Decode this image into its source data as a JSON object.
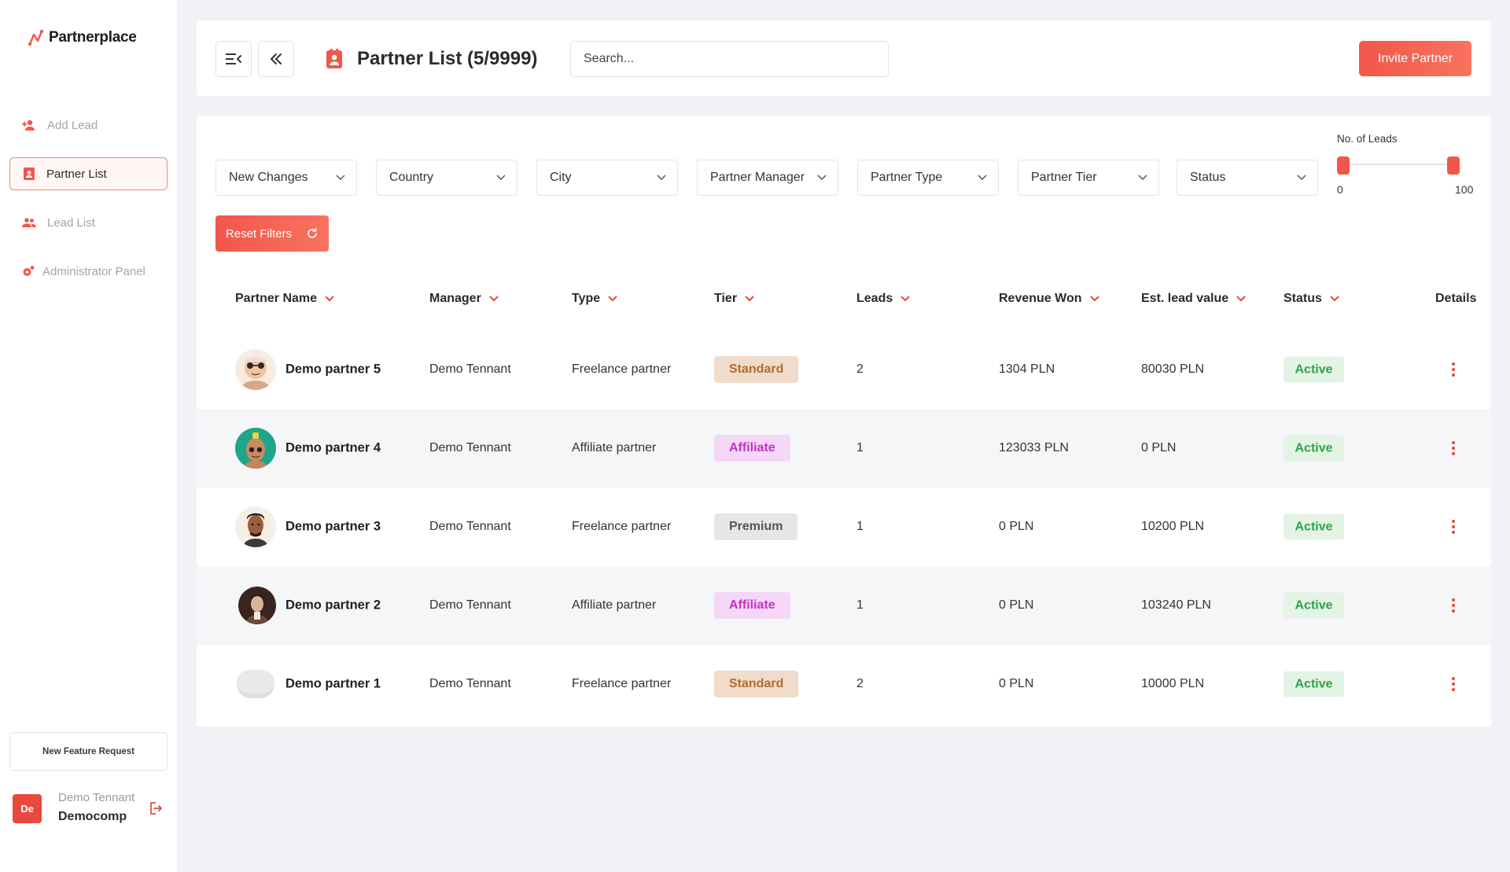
{
  "brand": {
    "name": "Partnerplace"
  },
  "sidebar": {
    "items": [
      {
        "label": "Add Lead",
        "icon": "user-plus-icon"
      },
      {
        "label": "Partner List",
        "icon": "contact-book-icon",
        "active": true
      },
      {
        "label": "Lead List",
        "icon": "users-icon"
      },
      {
        "label": "Administrator Panel",
        "icon": "gear-user-icon"
      }
    ],
    "feature_request": "New Feature Request",
    "user": {
      "initials": "De",
      "name": "Demo Tennant",
      "company": "Democomp"
    }
  },
  "header": {
    "title": "Partner List (5/9999)",
    "search_placeholder": "Search...",
    "invite_label": "Invite Partner"
  },
  "filters": {
    "items": [
      "New Changes",
      "Country",
      "City",
      "Partner Manager",
      "Partner Type",
      "Partner Tier",
      "Status"
    ],
    "leads_range": {
      "label": "No. of Leads",
      "min": "0",
      "max": "100",
      "value_low": 0,
      "value_high": 100
    },
    "reset_label": "Reset Filters"
  },
  "table": {
    "columns": [
      "Partner Name",
      "Manager",
      "Type",
      "Tier",
      "Leads",
      "Revenue Won",
      "Est. lead value",
      "Status",
      "Details"
    ],
    "rows": [
      {
        "name": "Demo partner 5",
        "manager": "Demo Tennant",
        "type": "Freelance partner",
        "tier": "Standard",
        "leads": "2",
        "revenue": "1304 PLN",
        "est_value": "80030 PLN",
        "status": "Active"
      },
      {
        "name": "Demo partner 4",
        "manager": "Demo Tennant",
        "type": "Affiliate partner",
        "tier": "Affiliate",
        "leads": "1",
        "revenue": "123033 PLN",
        "est_value": "0 PLN",
        "status": "Active"
      },
      {
        "name": "Demo partner 3",
        "manager": "Demo Tennant",
        "type": "Freelance partner",
        "tier": "Premium",
        "leads": "1",
        "revenue": "0 PLN",
        "est_value": "10200 PLN",
        "status": "Active"
      },
      {
        "name": "Demo partner 2",
        "manager": "Demo Tennant",
        "type": "Affiliate partner",
        "tier": "Affiliate",
        "leads": "1",
        "revenue": "0 PLN",
        "est_value": "103240 PLN",
        "status": "Active"
      },
      {
        "name": "Demo partner 1",
        "manager": "Demo Tennant",
        "type": "Freelance partner",
        "tier": "Standard",
        "leads": "2",
        "revenue": "0 PLN",
        "est_value": "10000 PLN",
        "status": "Active"
      }
    ]
  },
  "colors": {
    "accent": "#f2564a",
    "active_status": "#2fa44a",
    "tier_standard": "#b36a2a",
    "tier_affiliate": "#c232c8",
    "tier_premium": "#555555"
  }
}
